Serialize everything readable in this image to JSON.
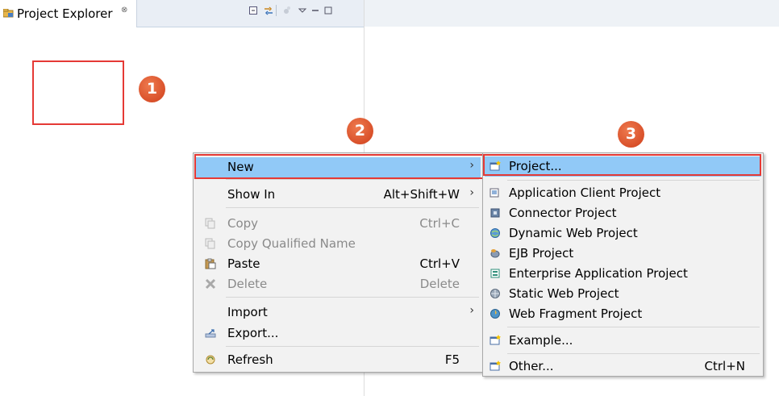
{
  "explorer": {
    "title": "Project Explorer",
    "close_glyph": "⊗"
  },
  "badges": [
    "1",
    "2",
    "3"
  ],
  "colors": {
    "highlight": "#91c9f7",
    "annotation_red": "#e53935",
    "badge": "#d9502a"
  },
  "context_menu": {
    "items": [
      {
        "label": "New",
        "accel": "",
        "submenu": true,
        "icon": "",
        "disabled": false,
        "highlighted": true
      },
      {
        "label": "Show In",
        "accel": "Alt+Shift+W",
        "submenu": true,
        "icon": "",
        "disabled": false
      },
      {
        "label": "Copy",
        "accel": "Ctrl+C",
        "icon": "copy-icon",
        "disabled": true
      },
      {
        "label": "Copy Qualified Name",
        "accel": "",
        "icon": "copy-qualified-icon",
        "disabled": true
      },
      {
        "label": "Paste",
        "accel": "Ctrl+V",
        "icon": "paste-icon",
        "disabled": false
      },
      {
        "label": "Delete",
        "accel": "Delete",
        "icon": "delete-icon",
        "disabled": true
      },
      {
        "label": "Import",
        "accel": "",
        "submenu": true,
        "icon": "",
        "disabled": false
      },
      {
        "label": "Export...",
        "accel": "",
        "icon": "export-icon",
        "disabled": false
      },
      {
        "label": "Refresh",
        "accel": "F5",
        "icon": "refresh-icon",
        "disabled": false
      }
    ]
  },
  "new_submenu": {
    "items": [
      {
        "label": "Project...",
        "accel": "",
        "icon": "project-icon",
        "highlighted": true
      },
      {
        "label": "Application Client Project",
        "icon": "app-client-project-icon"
      },
      {
        "label": "Connector Project",
        "icon": "connector-project-icon"
      },
      {
        "label": "Dynamic Web Project",
        "icon": "dynamic-web-project-icon"
      },
      {
        "label": "EJB Project",
        "icon": "ejb-project-icon"
      },
      {
        "label": "Enterprise Application Project",
        "icon": "enterprise-app-project-icon"
      },
      {
        "label": "Static Web Project",
        "icon": "static-web-project-icon"
      },
      {
        "label": "Web Fragment Project",
        "icon": "web-fragment-project-icon"
      },
      {
        "label": "Example...",
        "icon": "example-icon"
      },
      {
        "label": "Other...",
        "accel": "Ctrl+N",
        "icon": "other-wizard-icon"
      }
    ]
  }
}
